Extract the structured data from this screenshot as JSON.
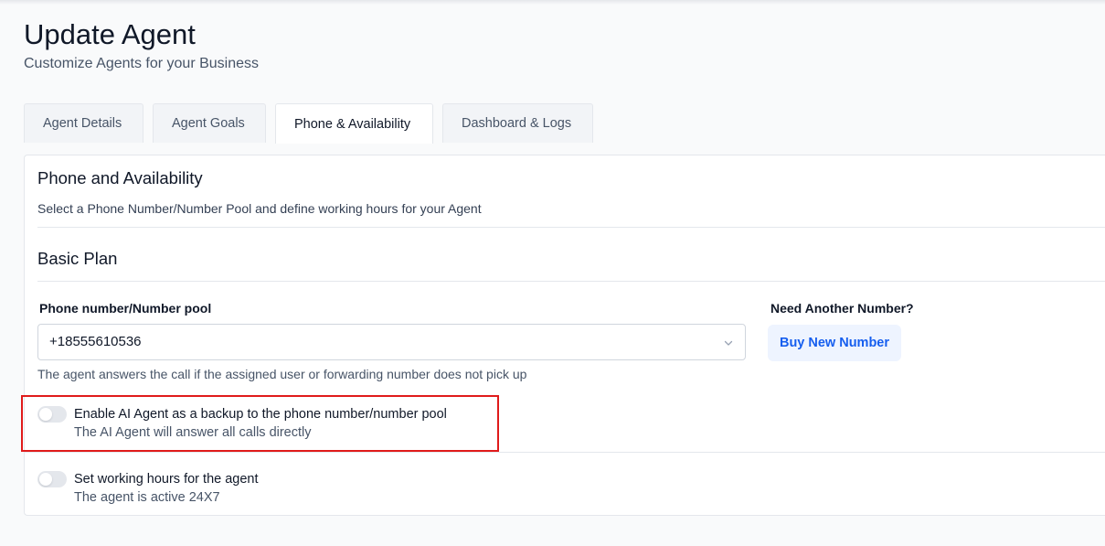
{
  "header": {
    "title": "Update Agent",
    "subtitle": "Customize Agents for your Business"
  },
  "tabs": [
    {
      "label": "Agent Details",
      "active": false
    },
    {
      "label": "Agent Goals",
      "active": false
    },
    {
      "label": "Phone & Availability",
      "active": true
    },
    {
      "label": "Dashboard & Logs",
      "active": false
    }
  ],
  "section": {
    "title": "Phone and Availability",
    "description": "Select a Phone Number/Number Pool and define working hours for your Agent",
    "plan_title": "Basic Plan"
  },
  "phone": {
    "label": "Phone number/Number pool",
    "value": "+18555610536",
    "help_text": "The agent answers the call if the assigned user or forwarding number does not pick up",
    "icon": "chevron-down-icon"
  },
  "buy": {
    "label": "Need Another Number?",
    "button_label": "Buy New Number"
  },
  "toggles": [
    {
      "title": "Enable AI Agent as a backup to the phone number/number pool",
      "description": "The AI Agent will answer all calls directly",
      "enabled": false
    },
    {
      "title": "Set working hours for the agent",
      "description": "The agent is active 24X7",
      "enabled": false
    }
  ],
  "colors": {
    "accent": "#155eef",
    "highlight": "#e01b1b",
    "toggle_off": "#e4e7ec"
  }
}
